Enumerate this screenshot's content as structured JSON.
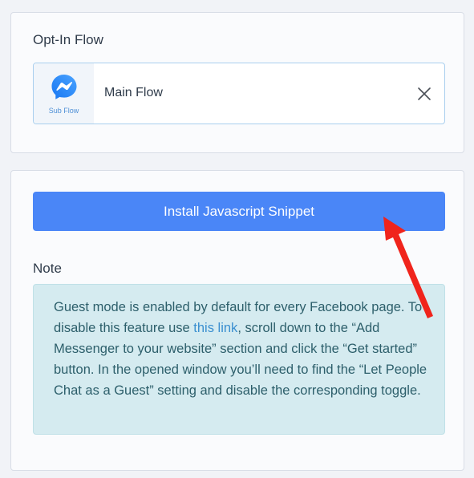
{
  "opt_in": {
    "label": "Opt-In Flow",
    "flow": {
      "type_label": "Sub Flow",
      "name": "Main Flow",
      "icon": "messenger-icon",
      "remove_icon": "close-icon"
    }
  },
  "install": {
    "button_label": "Install Javascript Snippet"
  },
  "note": {
    "label": "Note",
    "text_before_link": "Guest mode is enabled by default for every Facebook page. To disable this feature use ",
    "link_text": "this link",
    "text_after_link": ", scroll down to the “Add Messenger to your website” section and click the “Get started” button. In the opened window you’ll need to find the “Let People Chat as a Guest” setting and disable the corresponding toggle."
  },
  "colors": {
    "accent": "#4a86f7",
    "annotation_arrow": "#f0241c",
    "note_background": "#d5ebf0",
    "link": "#3a8fd0"
  }
}
